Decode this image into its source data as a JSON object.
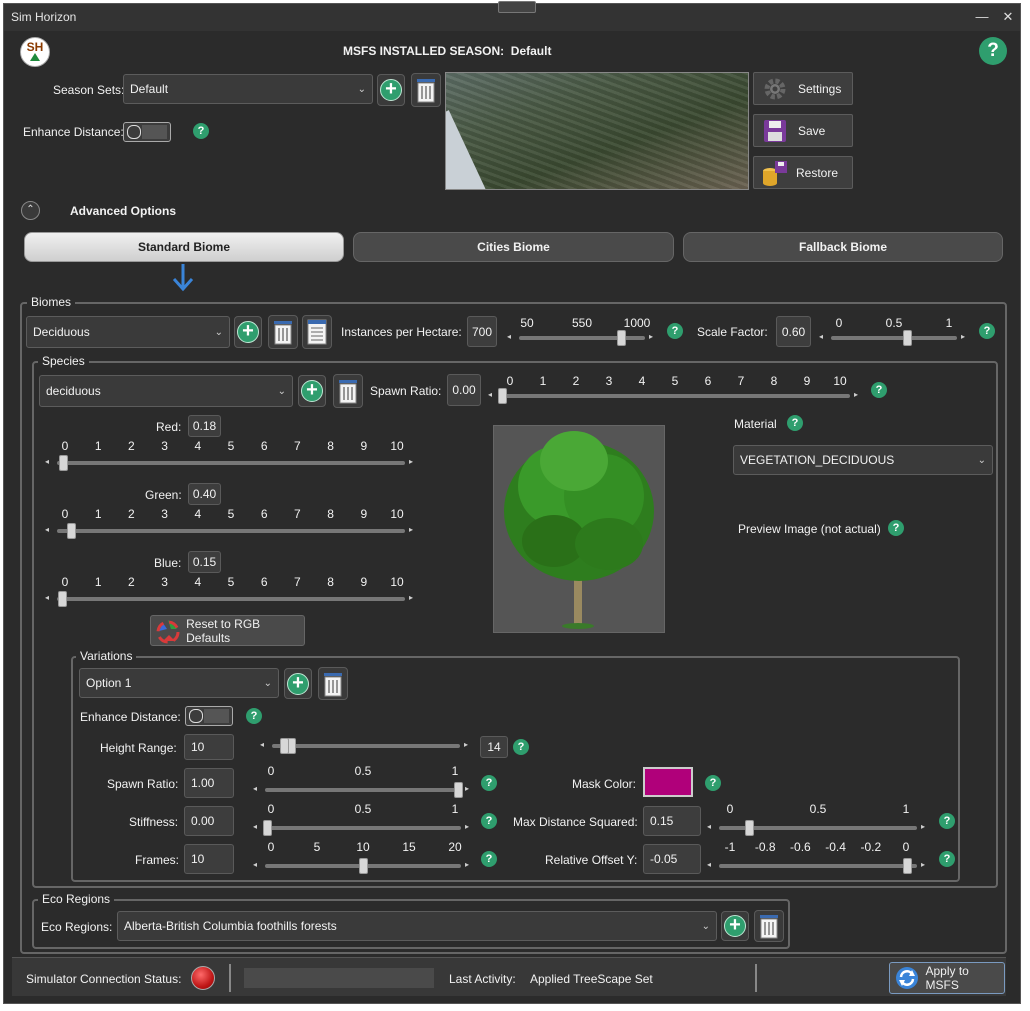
{
  "window": {
    "title": "Sim Horizon"
  },
  "header": {
    "logo_text": "SH",
    "season_label": "MSFS INSTALLED SEASON:",
    "season_value": "Default"
  },
  "season_sets": {
    "label": "Season Sets:",
    "value": "Default"
  },
  "enhance_distance": {
    "label": "Enhance Distance:"
  },
  "side_buttons": {
    "settings": "Settings",
    "save": "Save",
    "restore": "Restore"
  },
  "advanced": {
    "label": "Advanced Options"
  },
  "tabs": [
    {
      "label": "Standard Biome"
    },
    {
      "label": "Cities Biome"
    },
    {
      "label": "Fallback Biome"
    }
  ],
  "biomes": {
    "group_label": "Biomes",
    "value": "Deciduous",
    "instances_label": "Instances per Hectare:",
    "instances_value": "700",
    "instances_ticks": [
      "50",
      "550",
      "1000"
    ],
    "scale_label": "Scale Factor:",
    "scale_value": "0.60",
    "scale_ticks": [
      "0",
      "0.5",
      "1"
    ]
  },
  "species": {
    "group_label": "Species",
    "value": "deciduous",
    "spawn_label": "Spawn Ratio:",
    "spawn_value": "0.00",
    "spawn_ticks": [
      "0",
      "1",
      "2",
      "3",
      "4",
      "5",
      "6",
      "7",
      "8",
      "9",
      "10"
    ],
    "red_label": "Red:",
    "red_value": "0.18",
    "green_label": "Green:",
    "green_value": "0.40",
    "blue_label": "Blue:",
    "blue_value": "0.15",
    "rgb_ticks": [
      "0",
      "1",
      "2",
      "3",
      "4",
      "5",
      "6",
      "7",
      "8",
      "9",
      "10"
    ],
    "reset_label": "Reset to RGB Defaults",
    "material_label": "Material",
    "material_value": "VEGETATION_DECIDUOUS",
    "preview_label": "Preview Image (not actual)"
  },
  "variations": {
    "group_label": "Variations",
    "value": "Option 1",
    "enhance_label": "Enhance Distance:",
    "height_label": "Height Range:",
    "height_min": "10",
    "height_max": "14",
    "spawn_label": "Spawn Ratio:",
    "spawn_value": "1.00",
    "ticks_01": [
      "0",
      "0.5",
      "1"
    ],
    "stiffness_label": "Stiffness:",
    "stiffness_value": "0.00",
    "frames_label": "Frames:",
    "frames_value": "10",
    "frames_ticks": [
      "0",
      "5",
      "10",
      "15",
      "20"
    ],
    "mask_label": "Mask Color:",
    "mask_color": "#b0007a",
    "maxdist_label": "Max Distance Squared:",
    "maxdist_value": "0.15",
    "offset_label": "Relative Offset Y:",
    "offset_value": "-0.05",
    "offset_ticks": [
      "-1",
      "-0.8",
      "-0.6",
      "-0.4",
      "-0.2",
      "0"
    ]
  },
  "eco_regions": {
    "group_label": "Eco Regions",
    "label": "Eco Regions:",
    "value": "Alberta-British Columbia foothills forests"
  },
  "status": {
    "connection_label": "Simulator Connection Status:",
    "last_activity_label": "Last Activity:",
    "last_activity_value": "Applied TreeScape Set",
    "apply_label": "Apply to MSFS"
  },
  "levels": {
    "instances_fraction": 0.81,
    "scale_fraction": 0.6,
    "spawn_fraction": 0.0,
    "red_fraction": 0.018,
    "green_fraction": 0.04,
    "blue_fraction": 0.015,
    "height_fraction": 0.1,
    "var_spawn_fraction": 1.0,
    "stiffness_fraction": 0.0,
    "frames_fraction": 0.5,
    "maxdist_fraction": 0.15,
    "offset_fraction": 0.95
  },
  "colors": {
    "accent": "#2f9e6e",
    "background": "#2b2b2b",
    "status_red": "#cc1a1a",
    "link_arrow": "#3a84d8"
  }
}
